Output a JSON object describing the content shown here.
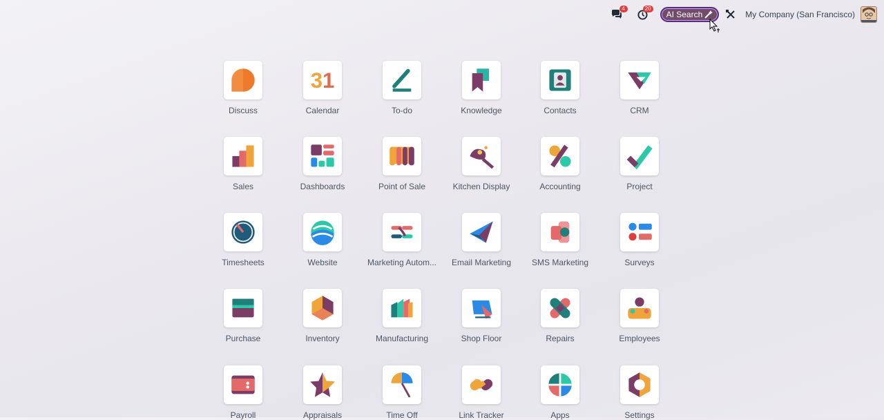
{
  "topbar": {
    "messages_badge": "4",
    "activities_badge": "20",
    "ai_search_label": "AI Search",
    "company": "My Company (San Francisco)"
  },
  "apps": [
    {
      "label": "Discuss",
      "icon": "discuss-icon"
    },
    {
      "label": "Calendar",
      "icon": "calendar-icon",
      "glyph": "31"
    },
    {
      "label": "To-do",
      "icon": "todo-icon"
    },
    {
      "label": "Knowledge",
      "icon": "knowledge-icon"
    },
    {
      "label": "Contacts",
      "icon": "contacts-icon"
    },
    {
      "label": "CRM",
      "icon": "crm-icon"
    },
    {
      "label": "Sales",
      "icon": "sales-icon"
    },
    {
      "label": "Dashboards",
      "icon": "dashboards-icon"
    },
    {
      "label": "Point of Sale",
      "icon": "point-of-sale-icon"
    },
    {
      "label": "Kitchen Display",
      "icon": "kitchen-display-icon"
    },
    {
      "label": "Accounting",
      "icon": "accounting-icon"
    },
    {
      "label": "Project",
      "icon": "project-icon"
    },
    {
      "label": "Timesheets",
      "icon": "timesheets-icon"
    },
    {
      "label": "Website",
      "icon": "website-icon"
    },
    {
      "label": "Marketing Autom...",
      "icon": "marketing-automation-icon"
    },
    {
      "label": "Email Marketing",
      "icon": "email-marketing-icon"
    },
    {
      "label": "SMS Marketing",
      "icon": "sms-marketing-icon"
    },
    {
      "label": "Surveys",
      "icon": "surveys-icon"
    },
    {
      "label": "Purchase",
      "icon": "purchase-icon"
    },
    {
      "label": "Inventory",
      "icon": "inventory-icon"
    },
    {
      "label": "Manufacturing",
      "icon": "manufacturing-icon"
    },
    {
      "label": "Shop Floor",
      "icon": "shop-floor-icon"
    },
    {
      "label": "Repairs",
      "icon": "repairs-icon"
    },
    {
      "label": "Employees",
      "icon": "employees-icon"
    },
    {
      "label": "Payroll",
      "icon": "payroll-icon"
    },
    {
      "label": "Appraisals",
      "icon": "appraisals-icon"
    },
    {
      "label": "Time Off",
      "icon": "time-off-icon"
    },
    {
      "label": "Link Tracker",
      "icon": "link-tracker-icon"
    },
    {
      "label": "Apps",
      "icon": "apps-icon"
    },
    {
      "label": "Settings",
      "icon": "settings-icon"
    }
  ]
}
